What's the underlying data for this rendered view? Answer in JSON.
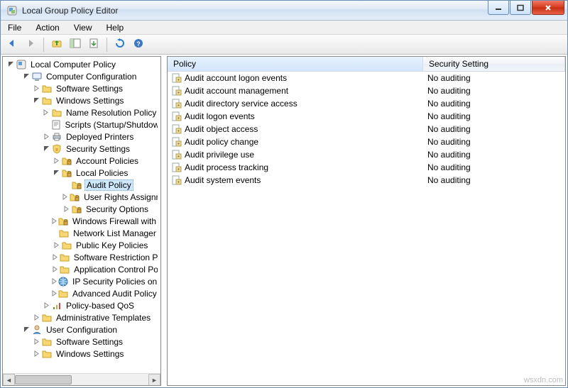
{
  "window": {
    "title": "Local Group Policy Editor"
  },
  "menubar": {
    "items": [
      "File",
      "Action",
      "View",
      "Help"
    ]
  },
  "toolbar": {
    "back": "back",
    "forward": "forward",
    "up": "up",
    "show_hide": "show-hide-tree",
    "export": "export-list",
    "refresh": "refresh",
    "help": "help"
  },
  "tree": {
    "root": {
      "label": "Local Computer Policy",
      "icon": "policy-root"
    },
    "nodes": [
      {
        "depth": 1,
        "exp": "open",
        "icon": "computer",
        "label": "Computer Configuration"
      },
      {
        "depth": 2,
        "exp": "closed",
        "icon": "folder",
        "label": "Software Settings"
      },
      {
        "depth": 2,
        "exp": "open",
        "icon": "folder",
        "label": "Windows Settings"
      },
      {
        "depth": 3,
        "exp": "closed",
        "icon": "folder",
        "label": "Name Resolution Policy"
      },
      {
        "depth": 3,
        "exp": "none",
        "icon": "script",
        "label": "Scripts (Startup/Shutdown)"
      },
      {
        "depth": 3,
        "exp": "closed",
        "icon": "printer",
        "label": "Deployed Printers"
      },
      {
        "depth": 3,
        "exp": "open",
        "icon": "security",
        "label": "Security Settings"
      },
      {
        "depth": 4,
        "exp": "closed",
        "icon": "folder-locked",
        "label": "Account Policies"
      },
      {
        "depth": 4,
        "exp": "open",
        "icon": "folder-locked",
        "label": "Local Policies"
      },
      {
        "depth": 5,
        "exp": "none",
        "icon": "folder-locked",
        "label": "Audit Policy",
        "selected": true
      },
      {
        "depth": 5,
        "exp": "closed",
        "icon": "folder-locked",
        "label": "User Rights Assignment"
      },
      {
        "depth": 5,
        "exp": "closed",
        "icon": "folder-locked",
        "label": "Security Options"
      },
      {
        "depth": 4,
        "exp": "closed",
        "icon": "folder-locked",
        "label": "Windows Firewall with Advanced Security"
      },
      {
        "depth": 4,
        "exp": "none",
        "icon": "folder",
        "label": "Network List Manager Policies"
      },
      {
        "depth": 4,
        "exp": "closed",
        "icon": "folder",
        "label": "Public Key Policies"
      },
      {
        "depth": 4,
        "exp": "closed",
        "icon": "folder",
        "label": "Software Restriction Policies"
      },
      {
        "depth": 4,
        "exp": "closed",
        "icon": "folder",
        "label": "Application Control Policies"
      },
      {
        "depth": 4,
        "exp": "closed",
        "icon": "ipsec",
        "label": "IP Security Policies on Local Computer"
      },
      {
        "depth": 4,
        "exp": "closed",
        "icon": "folder",
        "label": "Advanced Audit Policy Configuration"
      },
      {
        "depth": 3,
        "exp": "closed",
        "icon": "qos",
        "label": "Policy-based QoS"
      },
      {
        "depth": 2,
        "exp": "closed",
        "icon": "folder",
        "label": "Administrative Templates"
      },
      {
        "depth": 1,
        "exp": "open",
        "icon": "user",
        "label": "User Configuration"
      },
      {
        "depth": 2,
        "exp": "closed",
        "icon": "folder",
        "label": "Software Settings"
      },
      {
        "depth": 2,
        "exp": "closed",
        "icon": "folder",
        "label": "Windows Settings"
      }
    ]
  },
  "list": {
    "columns": {
      "policy": "Policy",
      "setting": "Security Setting"
    },
    "rows": [
      {
        "policy": "Audit account logon events",
        "setting": "No auditing"
      },
      {
        "policy": "Audit account management",
        "setting": "No auditing"
      },
      {
        "policy": "Audit directory service access",
        "setting": "No auditing"
      },
      {
        "policy": "Audit logon events",
        "setting": "No auditing"
      },
      {
        "policy": "Audit object access",
        "setting": "No auditing"
      },
      {
        "policy": "Audit policy change",
        "setting": "No auditing"
      },
      {
        "policy": "Audit privilege use",
        "setting": "No auditing"
      },
      {
        "policy": "Audit process tracking",
        "setting": "No auditing"
      },
      {
        "policy": "Audit system events",
        "setting": "No auditing"
      }
    ]
  },
  "watermark": "wsxdn.com"
}
